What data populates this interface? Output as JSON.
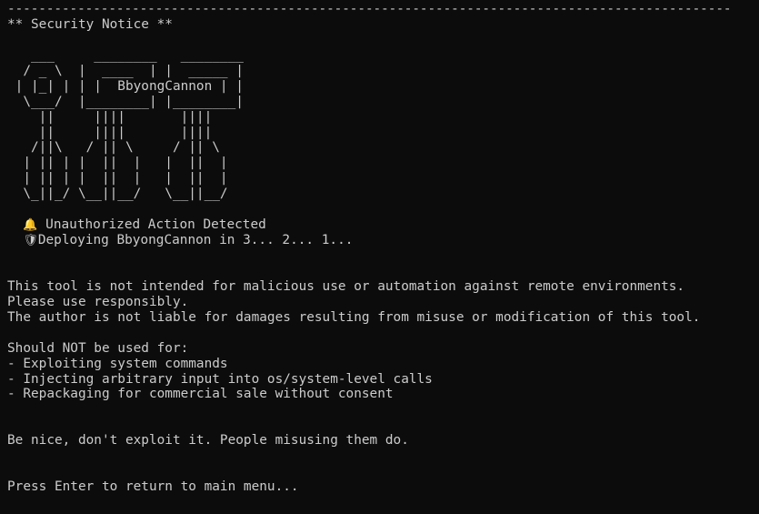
{
  "terminal": {
    "rule": "---------------------------------------------------------------------------------------------",
    "heading": "** Security Notice **",
    "art": [
      "   ___     ________   ________",
      "  / _ \\  |  ____  | |  _____ |",
      " | |_| | | |  BbyongCannon | |",
      "  \\___/  |________| |________|",
      "    ||     ||||       ||||",
      "    ||     ||||       ||||",
      "   /||\\   / || \\     / || \\",
      "  | || | |  ||  |   |  ||  |",
      "  | || | |  ||  |   |  ||  |",
      "  \\_||_/ \\__||__/   \\__||__/"
    ],
    "alert_icon": "bell-icon",
    "alert_glyph": "🔔",
    "alert_text": " Unauthorized Action Detected",
    "deploy_icon": "shield-icon",
    "deploy_glyph": "🛡",
    "deploy_text": "Deploying BbyongCannon in 3... 2... 1...",
    "disclaimer": [
      "This tool is not intended for malicious use or automation against remote environments.",
      "Please use responsibly.",
      "The author is not liable for damages resulting from misuse or modification of this tool."
    ],
    "not_used_heading": "Should NOT be used for:",
    "not_used_items": [
      "- Exploiting system commands",
      "- Injecting arbitrary input into os/system-level calls",
      "- Repackaging for commercial sale without consent"
    ],
    "closing": "Be nice, don't exploit it. People misusing them do.",
    "prompt": "Press Enter to return to main menu..."
  }
}
